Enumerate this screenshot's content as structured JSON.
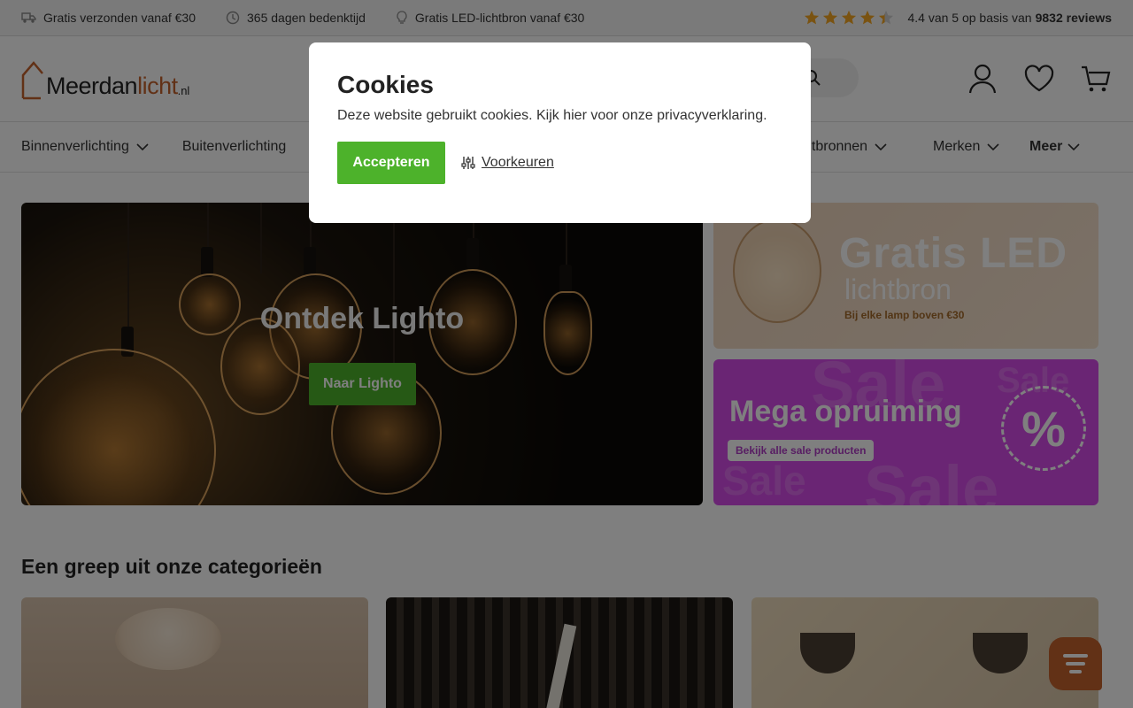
{
  "topbar": {
    "usps": [
      {
        "icon": "truck-icon",
        "label": "Gratis verzonden vanaf €30"
      },
      {
        "icon": "clock-icon",
        "label": "365 dagen bedenktijd"
      },
      {
        "icon": "lightbulb-icon",
        "label": "Gratis LED-lichtbron vanaf €30"
      }
    ],
    "rating": {
      "stars": 4.4,
      "text": "4.4 van 5 op basis van",
      "count": "9832 reviews"
    }
  },
  "header": {
    "logo_main": "Meerdan",
    "logo_accent": "licht",
    "logo_tld": ".nl",
    "icons": [
      "user-icon",
      "heart-icon",
      "cart-icon"
    ]
  },
  "nav": {
    "left": [
      "Binnenverlichting",
      "Buitenverlichting"
    ],
    "right": [
      "chtbronnen",
      "Merken"
    ],
    "more": "Meer"
  },
  "hero": {
    "title": "Ontdek Lighto",
    "button": "Naar Lighto"
  },
  "promo_led": {
    "title": "Gratis LED",
    "subtitle": "lichtbron",
    "caption": "Bij elke lamp boven €30"
  },
  "promo_sale": {
    "title": "Mega opruiming",
    "button": "Bekijk alle sale producten",
    "bg_word": "Sale",
    "badge": "%"
  },
  "categories": {
    "title": "Een greep uit onze categorieën"
  },
  "cookie_modal": {
    "title": "Cookies",
    "text": "Deze website gebruikt cookies. Kijk hier voor onze privacyverklaring.",
    "accept": "Accepteren",
    "preferences": "Voorkeuren"
  },
  "colors": {
    "accent_green": "#4db22b",
    "brand_orange": "#c4622d",
    "sale_purple": "#d54be8",
    "star_gold": "#f5a623"
  }
}
